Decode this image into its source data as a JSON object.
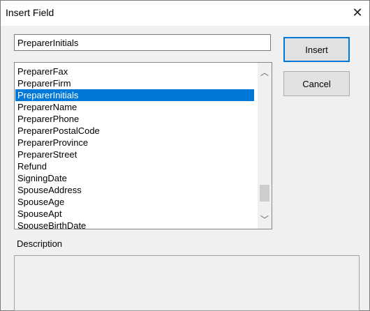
{
  "dialog": {
    "title": "Insert Field",
    "close_glyph": "✕"
  },
  "field_input": {
    "value": "PreparerInitials"
  },
  "buttons": {
    "insert_label": "Insert",
    "cancel_label": "Cancel"
  },
  "list": {
    "items": [
      "PreparerFax",
      "PreparerFirm",
      "PreparerInitials",
      "PreparerName",
      "PreparerPhone",
      "PreparerPostalCode",
      "PreparerProvince",
      "PreparerStreet",
      "Refund",
      "SigningDate",
      "SpouseAddress",
      "SpouseAge",
      "SpouseApt",
      "SpouseBirthDate"
    ],
    "selected_item": "PreparerInitials",
    "scroll_up_glyph": "︿",
    "scroll_down_glyph": "﹀"
  },
  "description": {
    "label": "Description",
    "text": ""
  },
  "colors": {
    "selection": "#0078d7",
    "dialog_bg": "#f0f0f0",
    "default_button_border": "#0078d7"
  }
}
